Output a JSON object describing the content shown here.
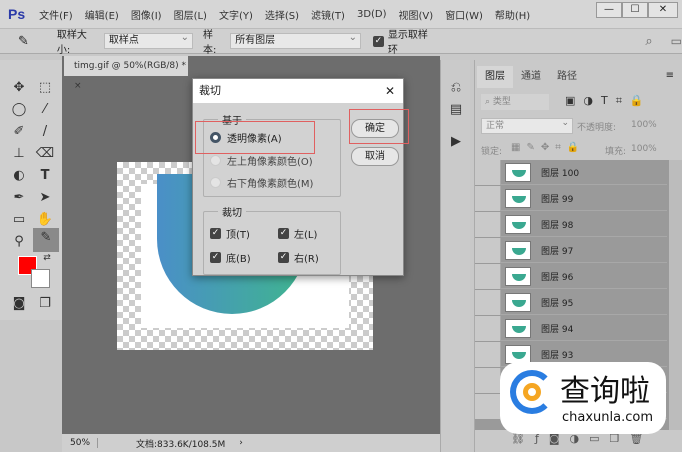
{
  "app": {
    "logo": "Ps",
    "menu": [
      "文件(F)",
      "编辑(E)",
      "图像(I)",
      "图层(L)",
      "文字(Y)",
      "选择(S)",
      "滤镜(T)",
      "3D(D)",
      "视图(V)",
      "窗口(W)",
      "帮助(H)"
    ],
    "win": [
      "—",
      "☐",
      "✕"
    ]
  },
  "options": {
    "size_label": "取样大小:",
    "size_value": "取样点",
    "sample_label": "样本:",
    "sample_value": "所有图层",
    "ring_label": "显示取样环"
  },
  "document": {
    "tab": "timg.gif @ 50%(RGB/8) *",
    "close": "×",
    "zoom": "50%",
    "doc_info": "文档:833.6K/108.5M"
  },
  "colors": {
    "foreground": "#ff0000",
    "background": "#ffffff"
  },
  "dialog": {
    "title": "裁切",
    "close": "✕",
    "based_on": "基于",
    "options": [
      "透明像素(A)",
      "左上角像素颜色(O)",
      "右下角像素颜色(M)"
    ],
    "selected": 0,
    "trim_label": "裁切",
    "checks": [
      "顶(T)",
      "左(L)",
      "底(B)",
      "右(R)"
    ],
    "ok": "确定",
    "cancel": "取消"
  },
  "layers_panel": {
    "tabs": [
      "图层",
      "通道",
      "路径"
    ],
    "filter": "类型",
    "blend": "正常",
    "opacity_label": "不透明度:",
    "opacity": "100%",
    "lock_label": "锁定:",
    "fill_label": "填充:",
    "fill": "100%",
    "layers": [
      "图层 100",
      "图层 99",
      "图层 98",
      "图层 97",
      "图层 96",
      "图层 95",
      "图层 94",
      "图层 93"
    ]
  },
  "watermark": {
    "text": "查询啦",
    "url": "chaxunla.com"
  }
}
